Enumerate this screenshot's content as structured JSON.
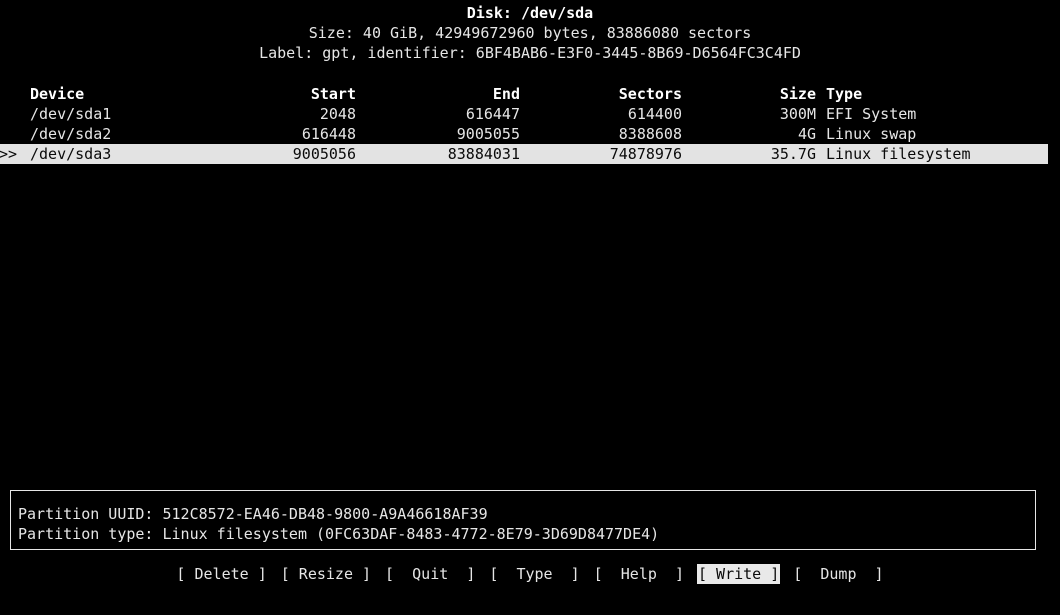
{
  "header": {
    "title": "Disk: /dev/sda",
    "size_line": "Size: 40 GiB, 42949672960 bytes, 83886080 sectors",
    "label_line": "Label: gpt, identifier: 6BF4BAB6-E3F0-3445-8B69-D6564FC3C4FD"
  },
  "table": {
    "columns": {
      "cursor": "",
      "device": "Device",
      "start": "Start",
      "end": "End",
      "sectors": "Sectors",
      "size": "Size",
      "type": "Type"
    },
    "rows": [
      {
        "cursor": "",
        "device": "/dev/sda1",
        "start": "2048",
        "end": "616447",
        "sectors": "614400",
        "size": "300M",
        "type": "EFI System",
        "selected": false
      },
      {
        "cursor": "",
        "device": "/dev/sda2",
        "start": "616448",
        "end": "9005055",
        "sectors": "8388608",
        "size": "4G",
        "type": "Linux swap",
        "selected": false
      },
      {
        "cursor": ">>",
        "device": "/dev/sda3",
        "start": "9005056",
        "end": "83884031",
        "sectors": "74878976",
        "size": "35.7G",
        "type": "Linux filesystem",
        "selected": true
      }
    ]
  },
  "info": {
    "uuid_line": "Partition UUID: 512C8572-EA46-DB48-9800-A9A46618AF39",
    "type_line": "Partition type: Linux filesystem (0FC63DAF-8483-4772-8E79-3D69D8477DE4)"
  },
  "menu": {
    "buttons": [
      {
        "label": "[ Delete ]",
        "selected": false
      },
      {
        "label": "[ Resize ]",
        "selected": false
      },
      {
        "label": "[  Quit  ]",
        "selected": false
      },
      {
        "label": "[  Type  ]",
        "selected": false
      },
      {
        "label": "[  Help  ]",
        "selected": false
      },
      {
        "label": "[ Write ]",
        "selected": true
      },
      {
        "label": "[  Dump  ]",
        "selected": false
      }
    ]
  },
  "colors": {
    "background": "#000000",
    "foreground": "#e6e6e6",
    "highlight_bg": "#e3e3e3",
    "highlight_fg": "#0a0a0a"
  }
}
